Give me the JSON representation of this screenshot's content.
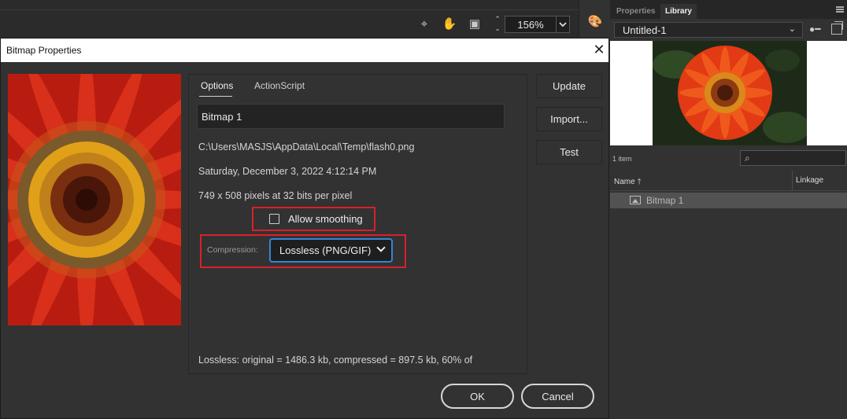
{
  "toolbar": {
    "zoom": "156%",
    "icons": [
      "snap-icon",
      "hand-icon",
      "clip-icon"
    ]
  },
  "library_panel": {
    "tabs": {
      "properties": "Properties",
      "library": "Library"
    },
    "document": "Untitled-1",
    "item_count": "1 item",
    "columns": {
      "name": "Name",
      "linkage": "Linkage"
    },
    "items": [
      {
        "label": "Bitmap 1",
        "icon": "bitmap-icon"
      }
    ]
  },
  "dialog": {
    "title": "Bitmap Properties",
    "tabs": {
      "options": "Options",
      "actionscript": "ActionScript"
    },
    "name_value": "Bitmap 1",
    "path": "C:\\Users\\MASJS\\AppData\\Local\\Temp\\flash0.png",
    "date": "Saturday, December 3, 2022  4:12:14 PM",
    "dimensions": "749 x 508 pixels at 32 bits per pixel",
    "allow_smoothing_label": "Allow smoothing",
    "allow_smoothing_checked": false,
    "compression_label": "Compression:",
    "compression_value": "Lossless (PNG/GIF)",
    "status_text": "Lossless: original = 1486.3 kb, compressed = 897.5 kb, 60% of",
    "buttons": {
      "update": "Update",
      "import": "Import...",
      "test": "Test",
      "ok": "OK",
      "cancel": "Cancel"
    }
  },
  "colors": {
    "highlight": "#d9202b",
    "focus": "#3b82d6",
    "dialog_bg": "#323232"
  }
}
